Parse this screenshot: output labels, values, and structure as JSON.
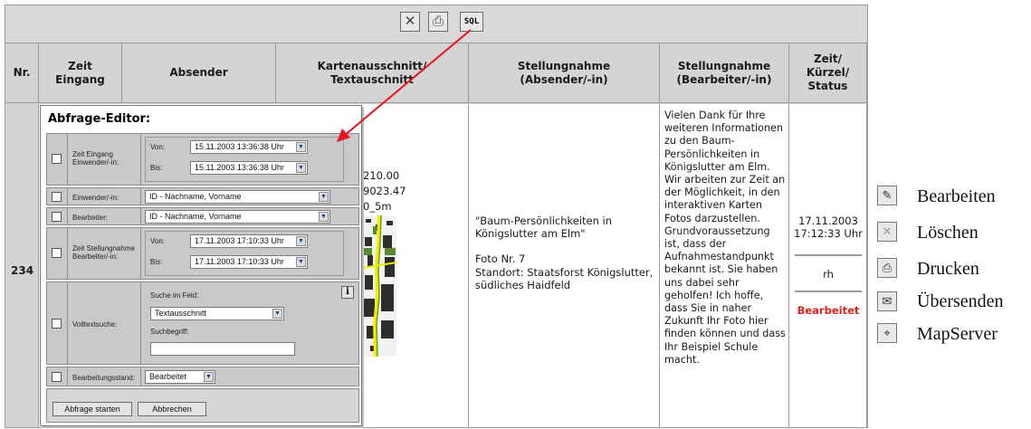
{
  "toolbar": {
    "delete_icon": "close-x-icon",
    "print_icon": "printer-icon",
    "sql_label": "SQL"
  },
  "table": {
    "headers": {
      "nr": "Nr.",
      "zeit_eingang": "Zeit\nEingang",
      "absender": "Absender",
      "kartenausschnitt": "Kartenausschnitt/\nTextauschnitt",
      "stellungnahme_absender": "Stellungnahme\n(Absender/-in)",
      "stellungnahme_bearbeiter": "Stellungnahme\n(Bearbeiter/-in)",
      "zeit_kuerzel_status": "Zeit/\nKürzel/\nStatus"
    },
    "row": {
      "nr": "234",
      "map_text_1": "210.00",
      "map_text_2": "9023.47",
      "map_text_3": "0_5m",
      "stellungnahme_absender_1": "\"Baum-Persönlichkeiten in Königslutter am Elm\"",
      "stellungnahme_absender_2": "Foto Nr. 7",
      "stellungnahme_absender_3": "Standort: Staatsforst Königslutter, südliches Haidfeld",
      "stellungnahme_bearbeiter": "Vielen Dank für Ihre weiteren Informationen zu den Baum-Persönlichkeiten in Königslutter am Elm. Wir arbeiten zur Zeit an der Möglichkeit, in den interaktiven Karten Fotos darzustellen. Grundvoraussetzung ist, dass der Aufnahmestandpunkt bekannt ist. Sie haben uns dabei sehr geholfen! Ich hoffe, dass Sie in naher Zukunft Ihr Foto hier finden können und dass Ihr Beispiel Schule macht.",
      "datum": "17.11.2003",
      "uhrzeit": "17:12:33 Uhr",
      "kuerzel": "rh",
      "status": "Bearbeitet"
    }
  },
  "editor": {
    "title": "Abfrage-Editor:",
    "zeit_eingang_label": "Zeit Eingang Einwender/-in:",
    "von_label": "Von:",
    "bis_label": "Bis:",
    "eingang_von": "15.11.2003 13:36:38 Uhr",
    "eingang_bis": "15.11.2003 13:36:38 Uhr",
    "einwender_label": "Einwender/-in:",
    "einwender_value": "ID - Nachname, Vorname",
    "bearbeiter_label": "Bearbeiter:",
    "bearbeiter_value": "ID - Nachname, Vorname",
    "zeit_stellungnahme_label": "Zeit Stellungnahme Bearbeiter/-in:",
    "stellungnahme_von": "17.11.2003 17:10:33 Uhr",
    "stellungnahme_bis": "17.11.2003 17:10:33 Uhr",
    "volltext_label": "Volltextsuche:",
    "suche_im_feld_label": "Suche im Feld:",
    "suche_im_feld_value": "Textausschnitt",
    "suchbegriff_label": "Suchbegriff:",
    "suchbegriff_value": "",
    "info_icon": "i",
    "bearbeitungsstand_label": "Bearbeitungsstand:",
    "bearbeitungsstand_value": "Bearbeitet",
    "start_button": "Abfrage starten",
    "cancel_button": "Abbrechen"
  },
  "actions": [
    {
      "icon": "edit-icon",
      "label": "Bearbeiten"
    },
    {
      "icon": "delete-icon",
      "label": "Löschen"
    },
    {
      "icon": "print-icon",
      "label": "Drucken"
    },
    {
      "icon": "send-icon",
      "label": "Übersenden"
    },
    {
      "icon": "mapserver-icon",
      "label": "MapServer"
    }
  ],
  "colors": {
    "status": "#e02020",
    "arrow": "#e8141e",
    "header_bg": "#d4d4d4"
  }
}
